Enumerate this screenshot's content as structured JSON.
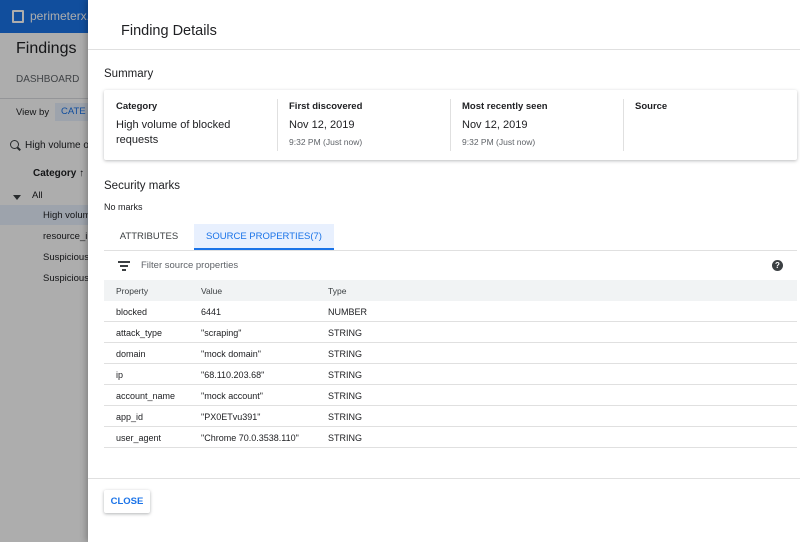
{
  "background": {
    "project_name": "perimeterx.c",
    "page_title": "Findings",
    "tab": "DASHBOARD",
    "view_by_label": "View by",
    "view_by_value": "CATE",
    "search_text": "High volume o",
    "column_header": "Category ↑",
    "tree_root": "All",
    "rows": [
      "High volum",
      "resource_in",
      "Suspicious",
      "Suspicious"
    ]
  },
  "panel": {
    "title": "Finding Details",
    "summary": {
      "heading": "Summary",
      "category_label": "Category",
      "category_value": "High volume of blocked requests",
      "first_discovered_label": "First discovered",
      "first_discovered_date": "Nov 12, 2019",
      "first_discovered_time": "9:32 PM (Just now)",
      "most_recent_label": "Most recently seen",
      "most_recent_date": "Nov 12, 2019",
      "most_recent_time": "9:32 PM (Just now)",
      "source_label": "Source"
    },
    "security_marks": {
      "heading": "Security marks",
      "value": "No marks"
    },
    "tabs": [
      {
        "label": "ATTRIBUTES",
        "active": false
      },
      {
        "label": "SOURCE PROPERTIES(7)",
        "active": true
      }
    ],
    "filter_placeholder": "Filter source properties",
    "table": {
      "headers": [
        "Property",
        "Value",
        "Type"
      ],
      "rows": [
        [
          "blocked",
          "6441",
          "NUMBER"
        ],
        [
          "attack_type",
          "\"scraping\"",
          "STRING"
        ],
        [
          "domain",
          "\"mock domain\"",
          "STRING"
        ],
        [
          "ip",
          "\"68.110.203.68\"",
          "STRING"
        ],
        [
          "account_name",
          "\"mock account\"",
          "STRING"
        ],
        [
          "app_id",
          "\"PX0ETvu391\"",
          "STRING"
        ],
        [
          "user_agent",
          "\"Chrome 70.0.3538.110\"",
          "STRING"
        ]
      ]
    },
    "close_label": "CLOSE"
  },
  "colors": {
    "accent": "#1a73e8",
    "active_tab_bg": "#e8f0fe",
    "scrim": "rgba(0,0,0,0.32)"
  },
  "icons": [
    "grid-logo-icon",
    "search-icon",
    "expand-arrow-icon",
    "filter-icon",
    "help-icon"
  ]
}
